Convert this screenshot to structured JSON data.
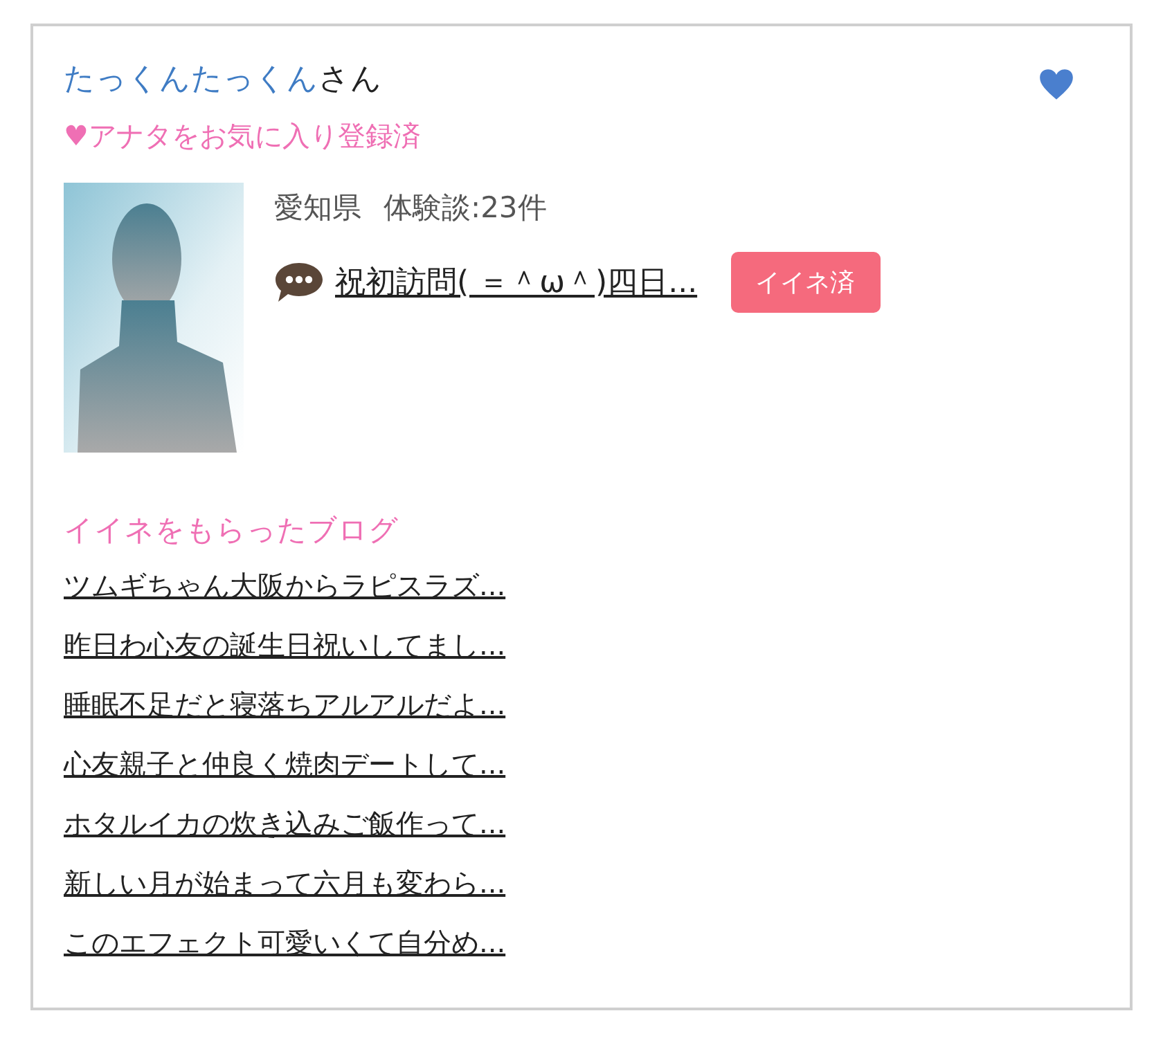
{
  "user": {
    "name": "たっくんたっくん",
    "suffix": "さん",
    "favorite_note": "♥アナタをお気に入り登録済"
  },
  "profile": {
    "area": "愛知県",
    "reviews": "体験談:23件",
    "latest_post": "祝初訪問( ＝＾ω＾)四日...",
    "like_button": "イイネ済"
  },
  "liked_blogs": {
    "title": "イイネをもらったブログ",
    "items": [
      "ツムギちゃん大阪からラピスラズ...",
      "昨日わ心友の誕生日祝いしてまし...",
      "睡眠不足だと寝落ちアルアルだよ...",
      "心友親子と仲良く焼肉デートして...",
      "ホタルイカの炊き込みご飯作って...",
      "新しい月が始まって六月も変わら...",
      "このエフェクト可愛いくて自分め..."
    ]
  }
}
